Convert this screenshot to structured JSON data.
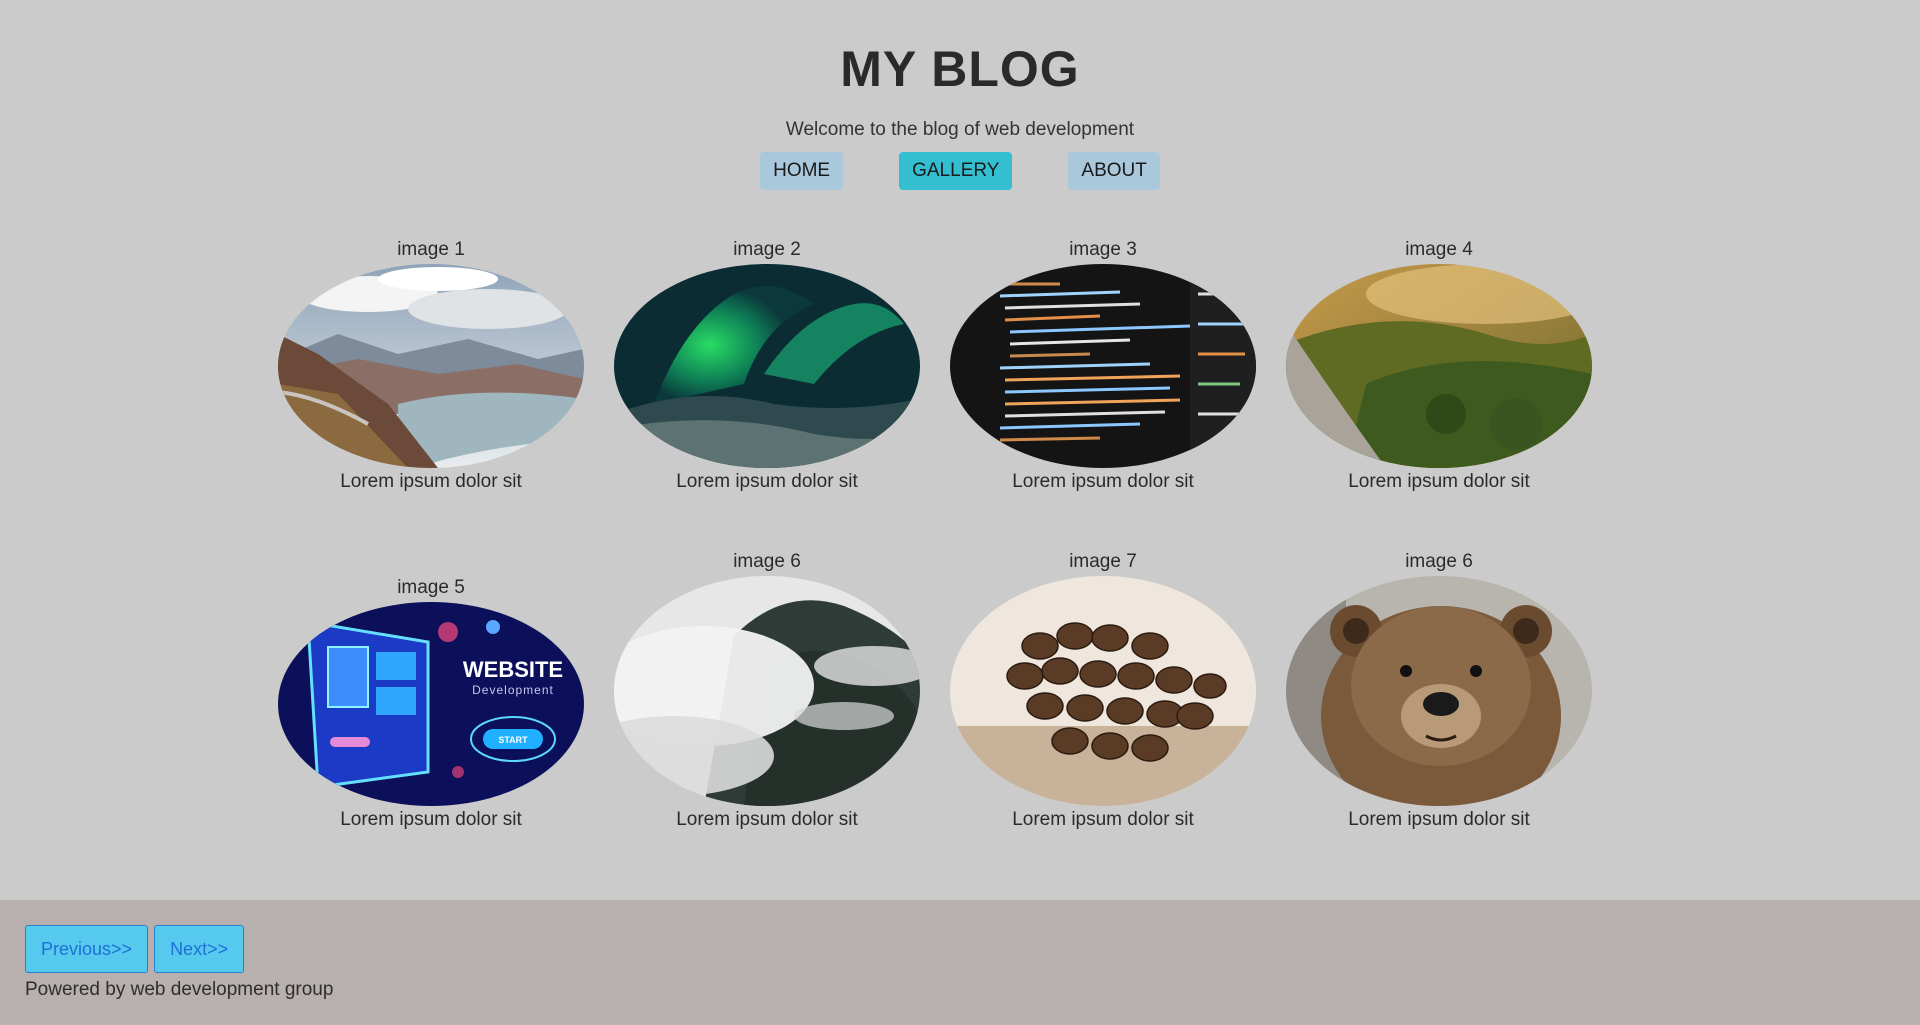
{
  "header": {
    "title": "MY BLOG",
    "subtitle": "Welcome to the blog of web development"
  },
  "nav": {
    "items": [
      {
        "label": "HOME",
        "active": false
      },
      {
        "label": "GALLERY",
        "active": true
      },
      {
        "label": "ABOUT",
        "active": false
      }
    ]
  },
  "gallery": {
    "cards": [
      {
        "title": "image 1",
        "caption": "Lorem ipsum dolor sit",
        "icon": "mountain-lake-photo"
      },
      {
        "title": "image 2",
        "caption": "Lorem ipsum dolor sit",
        "icon": "aurora-photo"
      },
      {
        "title": "image 3",
        "caption": "Lorem ipsum dolor sit",
        "icon": "code-screen-photo"
      },
      {
        "title": "image 4",
        "caption": "Lorem ipsum dolor sit",
        "icon": "forest-valley-photo"
      },
      {
        "title": "image 5",
        "caption": "Lorem ipsum dolor sit",
        "icon": "website-development-illustration",
        "overlay_title": "WEBSITE",
        "overlay_subtitle": "Development",
        "overlay_button": "START"
      },
      {
        "title": "image 6",
        "caption": "Lorem ipsum dolor sit",
        "icon": "misty-mountain-photo"
      },
      {
        "title": "image 7",
        "caption": "Lorem ipsum dolor sit",
        "icon": "coffee-beans-photo"
      },
      {
        "title": "image 6",
        "caption": "Lorem ipsum dolor sit",
        "icon": "bear-photo"
      }
    ]
  },
  "footer": {
    "previous_label": "Previous>>",
    "next_label": "Next>>",
    "powered_by": "Powered by web development group"
  },
  "colors": {
    "background": "#cbcbcb",
    "nav_button": "#a9c8dc",
    "nav_active": "#33bfd0",
    "footer": "#b8afaf",
    "pager_button": "#56c9ef"
  }
}
